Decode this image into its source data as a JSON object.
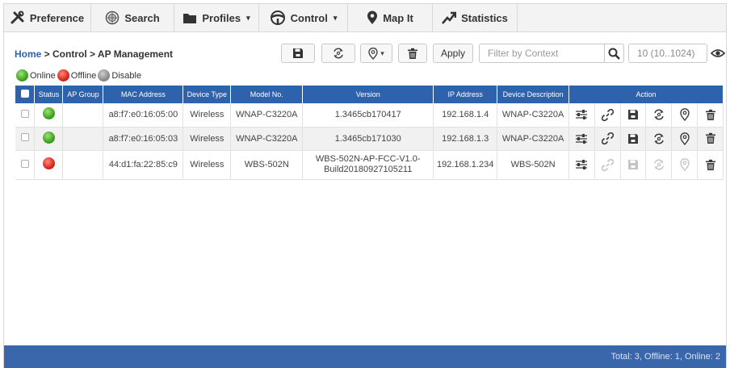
{
  "nav": {
    "items": [
      {
        "label": "Preference",
        "icon": "wrench-screwdriver-icon"
      },
      {
        "label": "Search",
        "icon": "search-globe-icon"
      },
      {
        "label": "Profiles",
        "icon": "folder-icon",
        "dropdown": true
      },
      {
        "label": "Control",
        "icon": "steering-wheel-icon",
        "dropdown": true
      },
      {
        "label": "Map It",
        "icon": "map-pin-icon"
      },
      {
        "label": "Statistics",
        "icon": "trend-arrow-icon"
      }
    ]
  },
  "breadcrumb": {
    "home": "Home",
    "rest": " > Control > AP Management"
  },
  "toolbar": {
    "apply_label": "Apply",
    "filter_placeholder": "Filter by Context",
    "pager_text": "10 (10..1024)"
  },
  "legend": {
    "online": "Online",
    "offline": "Offline",
    "disable": "Disable"
  },
  "colors": {
    "header_blue": "#2f62ac",
    "footer_blue": "#3a67ab",
    "online": "#3fa11e",
    "offline": "#d8261b",
    "disable": "#8c8c8c",
    "link_blue": "#2a64b0"
  },
  "table": {
    "headers": [
      "Status",
      "AP Group",
      "MAC Address",
      "Device Type",
      "Model No.",
      "Version",
      "IP Address",
      "Device Description",
      "Action"
    ],
    "rows": [
      {
        "status": "online",
        "ap_group": "",
        "mac": "a8:f7:e0:16:05:00",
        "device_type": "Wireless",
        "model": "WNAP-C3220A",
        "version": "1.3465cb170417",
        "version_line2": "",
        "ip": "192.168.1.4",
        "description": "WNAP-C3220A",
        "actions_enabled": true
      },
      {
        "status": "online",
        "ap_group": "",
        "mac": "a8:f7:e0:16:05:03",
        "device_type": "Wireless",
        "model": "WNAP-C3220A",
        "version": "1.3465cb171030",
        "version_line2": "",
        "ip": "192.168.1.3",
        "description": "WNAP-C3220A",
        "actions_enabled": true
      },
      {
        "status": "offline",
        "ap_group": "",
        "mac": "44:d1:fa:22:85:c9",
        "device_type": "Wireless",
        "model": "WBS-502N",
        "version": "WBS-502N-AP-FCC-V1.0-",
        "version_line2": "Build20180927105211",
        "ip": "192.168.1.234",
        "description": "WBS-502N",
        "actions_enabled": false
      }
    ],
    "action_icons": [
      "settings-sliders-icon",
      "link-icon",
      "save-disk-icon",
      "sync-icon",
      "map-pin-icon",
      "trash-icon"
    ]
  },
  "footer": {
    "summary": "Total: 3, Offline: 1, Online: 2"
  }
}
